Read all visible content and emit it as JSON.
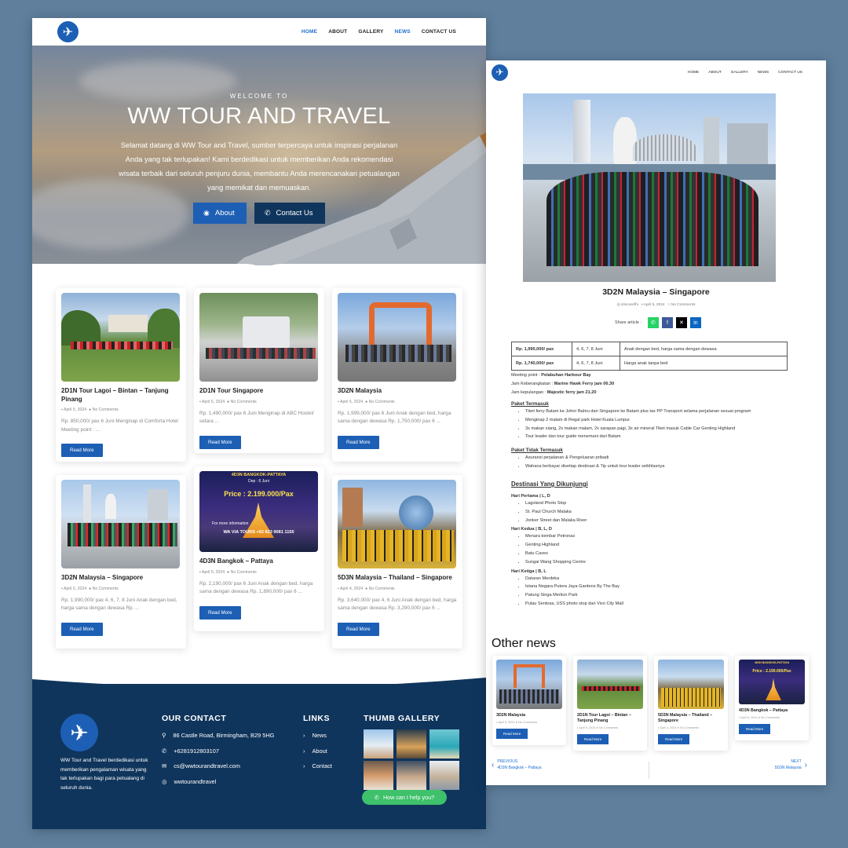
{
  "nav": {
    "items": [
      "HOME",
      "ABOUT",
      "GALLERY",
      "NEWS",
      "CONTACT US"
    ]
  },
  "hero": {
    "welcome": "WELCOME TO",
    "title": "WW TOUR AND TRAVEL",
    "description": "Selamat datang di WW Tour and Travel, sumber terpercaya untuk inspirasi perjalanan Anda yang tak terlupakan! Kami berdedikasi untuk memberikan Anda rekomendasi wisata terbaik dari seluruh penjuru dunia, membantu Anda merencanakan petualangan yang memikat dan memuaskan.",
    "about_label": "About",
    "contact_label": "Contact Us"
  },
  "cards": [
    {
      "title": "2D1N Tour Lagoi – Bintan – Tanjung Pinang",
      "date": "April 5, 2024",
      "comments": "No Comments",
      "excerpt": "Rp. 850,000/ pax 6 Juni Menginap di Comforta Hotel Meeting point : ...",
      "button": "Read More"
    },
    {
      "title": "2D1N Tour Singapore",
      "date": "April 5, 2024",
      "comments": "No Comments",
      "excerpt": "Rp. 1,490,000/ pax 6 Juni Menginap di ABC Hostel/ setara ...",
      "button": "Read More"
    },
    {
      "title": "3D2N Malaysia",
      "date": "April 5, 2024",
      "comments": "No Comments",
      "excerpt": "Rp. 1,999,000/ pax 6 Juni Anak dengan bed, harga sama dengan dewasa Rp. 1,750,000/ pax 6 ...",
      "button": "Read More"
    },
    {
      "title": "3D2N Malaysia – Singapore",
      "date": "April 5, 2024",
      "comments": "No Comments",
      "excerpt": "Rp. 1,990,000/ pax 4, 6, 7, 8 Juni Anak dengan bed, harga sama dengan dewasa Rp. ...",
      "button": "Read More"
    },
    {
      "title": "4D3N Bangkok – Pattaya",
      "date": "April 5, 2024",
      "comments": "No Comments",
      "excerpt": "Rp. 2,190,000/ pax 6 Juni Anak dengan bed, harga sama dengan dewasa Rp. 1,890,000/ pax 6 ...",
      "button": "Read More"
    },
    {
      "title": "5D3N Malaysia – Thailand – Singapore",
      "date": "April 4, 2024",
      "comments": "No Comments",
      "excerpt": "Rp. 3,640,000/ pax 4, 6 Juni Anak dengan bed, harga sama dengan dewasa Rp. 3,290,000/ pax 6 ...",
      "button": "Read More"
    }
  ],
  "poster": {
    "line1": "4D3N BANGKOK-PATTAYA",
    "line2": "Dep : 6 Juni",
    "line3": "Price : 2.199.000/Pax",
    "line4": "For more information",
    "line5": "WA VIA TOURS +62 823 9081 1155"
  },
  "footer": {
    "about": "WW Tour and Travel berdedikasi untuk memberikan pengalaman wisata yang tak terlupakan bagi para petualang di seluruh dunia.",
    "contact_heading": "OUR CONTACT",
    "address": "86 Castle Road, Birmingham, B29 5HG",
    "phone": "+6281912803107",
    "email": "cs@wwtourandtravel.com",
    "instagram": "wwtourandtravel",
    "links_heading": "LINKS",
    "links": [
      "News",
      "About",
      "Contact"
    ],
    "gallery_heading": "THUMB GALLERY",
    "whatsapp": "How can I help you?"
  },
  "article": {
    "title": "3D2N Malaysia – Singapore",
    "author": "sriscarefhi",
    "date": "April 5, 2024",
    "comments": "No Comments",
    "share_label": "Share article :",
    "price_rows": [
      {
        "price": "Rp. 1,990,000/ pax",
        "dates": "4, 6, 7, 8 Juni",
        "note": "Anak dengan bed, harga sama dengan dewasa"
      },
      {
        "price": "Rp. 1,740,000/ pax",
        "dates": "4, 6, 7, 8 Juni",
        "note": "Harga anak tanpa bed"
      }
    ],
    "meeting_label": "Meeting point : ",
    "meeting_value": "Pelabuhan Harbour Bay",
    "depart_label": "Jam Keberangkatan : ",
    "depart_value": "Marine Hawk Ferry jam 06.30",
    "return_label": "Jam kepulangan : ",
    "return_value": "Majestic ferry jam 21.20",
    "include_heading": "Paket Termasuk",
    "include": [
      "Tiket ferry Batam ke Johor Bahru dan Singapore ke Batam plus tax PP     Transport selama perjalanan sesuai program",
      "Menginap 2 malam di Regal park Hotel Kuala Lumpur",
      "3x makan siang, 2x makan malam, 2x sarapan pagi, 3x air mineral     Tiket masuk Cable Car Genting Highland",
      "Tour leader dan tour guide menemani dari Batam"
    ],
    "exclude_heading": "Paket Tidak Termasuk",
    "exclude": [
      "Asuransi perjalanan & Pengeluaran pribadi",
      "Wahana berbayar disetiap destinasi & Tip untuk tour leader seikhlasnya"
    ],
    "dest_heading": "Destinasi Yang Dikunjungi",
    "day1": "Hari Pertama | L, D",
    "day1_items": [
      "Lagoland Photo Stop",
      "St. Paul Church Malaka",
      "Jonker Street dan Malaka River"
    ],
    "day2": "Hari Kedua | B, L, D",
    "day2_items": [
      "Menara kembar Petronas",
      "Genting Highland",
      "Batu Caves",
      "Sungai Wang Shopping Centre"
    ],
    "day3": "Hari Ketiga | B, L",
    "day3_items": [
      "Dataran Merdeka",
      "Istana Negara Putera Jaya     Gardens By The Bay",
      "Patung Singa Merlion Park",
      "Pulau Sentosa, USS photo stop dan Vivo City Mall"
    ]
  },
  "other_news": {
    "heading": "Other news",
    "items": [
      {
        "title": "3D2N Malaysia",
        "date": "April 5, 2024",
        "comments": "No Comments",
        "button": "Read More"
      },
      {
        "title": "2D1N Tour Lagoi – Bintan – Tanjung Pinang",
        "date": "April 5, 2024",
        "comments": "No Comments",
        "button": "Read More"
      },
      {
        "title": "5D3N Malaysia – Thailand – Singapore",
        "date": "April 4, 2024",
        "comments": "No Comments",
        "button": "Read More"
      },
      {
        "title": "4D3N Bangkok – Pattaya",
        "date": "April 5, 2024",
        "comments": "No Comments",
        "button": "Read More"
      }
    ],
    "prev_label": "PREVIOUS",
    "prev_title": "4D3N Bangkok – Pattaya",
    "next_label": "NEXT",
    "next_title": "5D3N Malaysia"
  },
  "colors": {
    "brand": "#1d5fb4",
    "footer": "#10355c",
    "whatsapp": "#3ec16a"
  }
}
